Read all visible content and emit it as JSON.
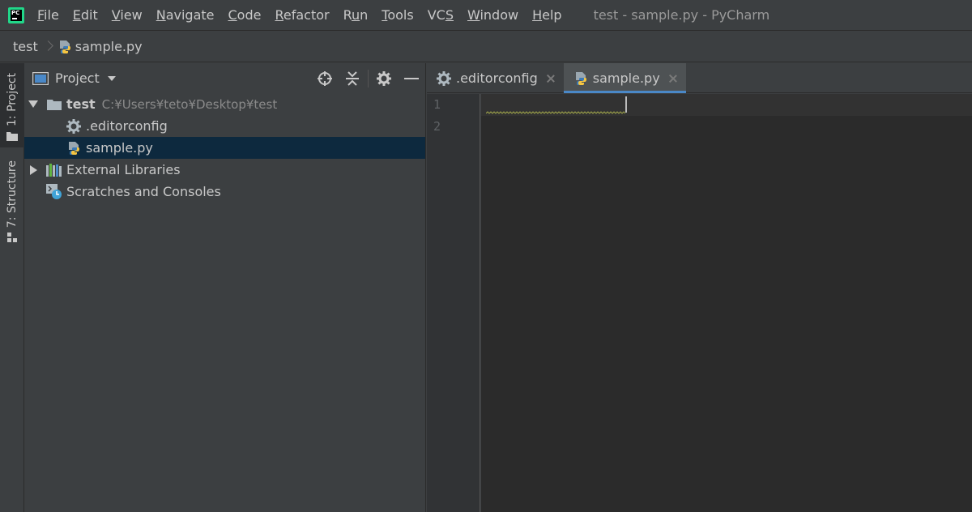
{
  "app": {
    "logo_text": "PC",
    "window_title": "test - sample.py - PyCharm"
  },
  "menu": [
    {
      "label": "File",
      "mnemonic": "F",
      "rest": "ile"
    },
    {
      "label": "Edit",
      "mnemonic": "E",
      "rest": "dit"
    },
    {
      "label": "View",
      "mnemonic": "V",
      "rest": "iew"
    },
    {
      "label": "Navigate",
      "mnemonic": "N",
      "rest": "avigate"
    },
    {
      "label": "Code",
      "mnemonic": "C",
      "rest": "ode"
    },
    {
      "label": "Refactor",
      "mnemonic": "R",
      "rest": "efactor"
    },
    {
      "label": "Run",
      "mnemonic": "",
      "pre": "R",
      "mid": "u",
      "rest": "n"
    },
    {
      "label": "Tools",
      "mnemonic": "T",
      "rest": "ools"
    },
    {
      "label": "VCS",
      "mnemonic": "",
      "pre": "VC",
      "mid": "S",
      "rest": ""
    },
    {
      "label": "Window",
      "mnemonic": "W",
      "rest": "indow"
    },
    {
      "label": "Help",
      "mnemonic": "H",
      "rest": "elp"
    }
  ],
  "breadcrumb": {
    "project": "test",
    "file": "sample.py"
  },
  "toolstrip": {
    "project_tab": "1: Project",
    "structure_tab": "7: Structure"
  },
  "project_panel": {
    "title": "Project",
    "tree": {
      "root_name": "test",
      "root_path": "C:¥Users¥teto¥Desktop¥test",
      "editorconfig": ".editorconfig",
      "sample": "sample.py",
      "external_libraries": "External Libraries",
      "scratches": "Scratches and Consoles"
    }
  },
  "editor": {
    "tabs": [
      {
        "label": ".editorconfig",
        "active": false
      },
      {
        "label": "sample.py",
        "active": true
      }
    ],
    "line_numbers": [
      "1",
      "2"
    ]
  },
  "colors": {
    "accent": "#4a88c7",
    "selection": "#0d293e",
    "logo_green": "#21d789"
  }
}
